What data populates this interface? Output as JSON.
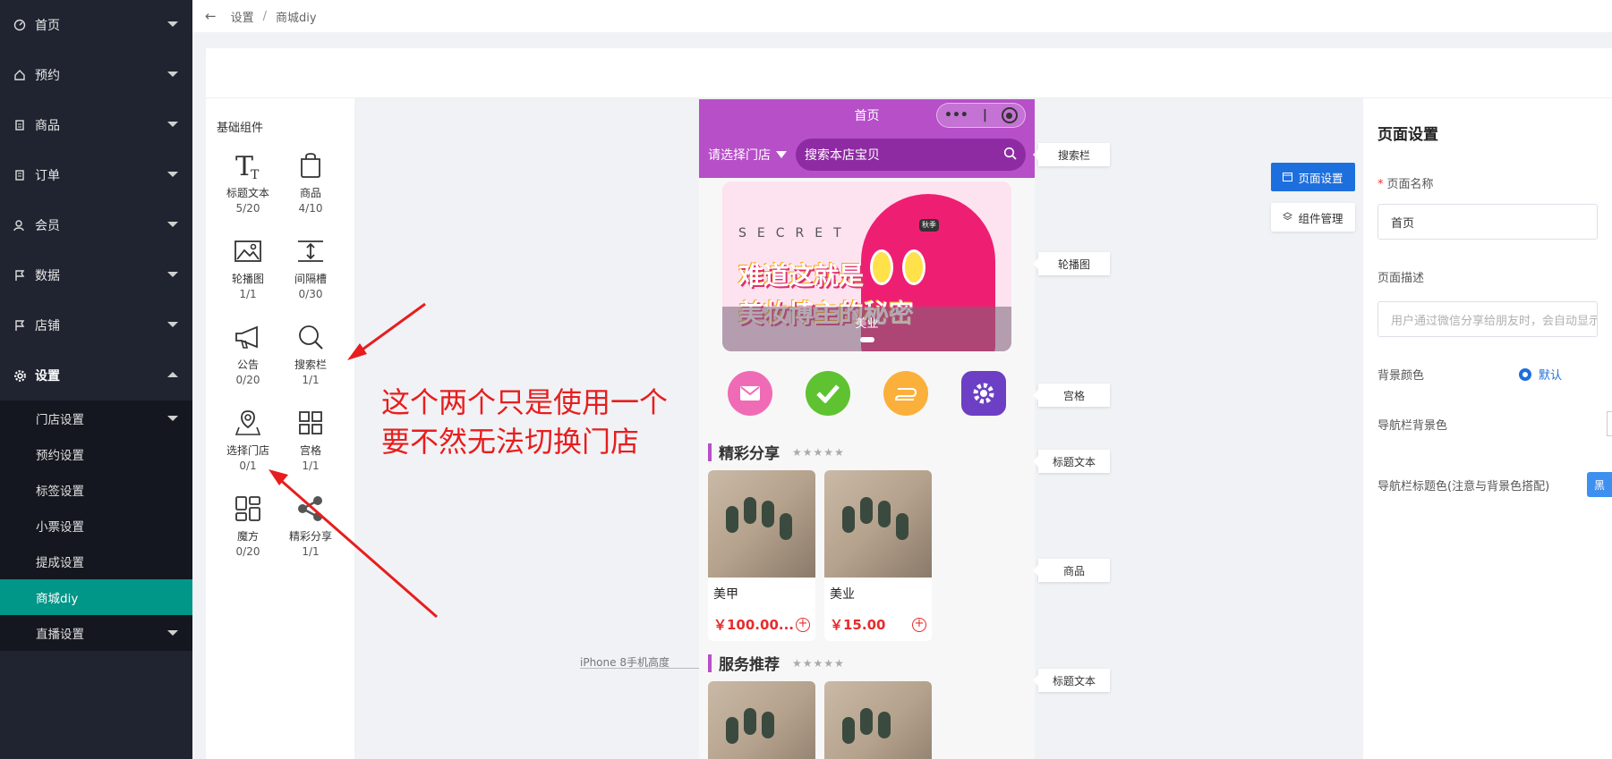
{
  "sidebar": {
    "items": [
      {
        "label": "首页",
        "icon": "dashboard-icon"
      },
      {
        "label": "预约",
        "icon": "home-icon"
      },
      {
        "label": "商品",
        "icon": "document-icon"
      },
      {
        "label": "订单",
        "icon": "order-icon"
      },
      {
        "label": "会员",
        "icon": "user-icon"
      },
      {
        "label": "数据",
        "icon": "flag-icon"
      },
      {
        "label": "店铺",
        "icon": "flag-icon"
      },
      {
        "label": "设置",
        "icon": "gear-icon"
      }
    ],
    "submenu": [
      {
        "label": "门店设置"
      },
      {
        "label": "预约设置"
      },
      {
        "label": "标签设置"
      },
      {
        "label": "小票设置"
      },
      {
        "label": "提成设置"
      },
      {
        "label": "商城diy"
      },
      {
        "label": "直播设置"
      }
    ]
  },
  "breadcrumb": {
    "parent": "设置",
    "current": "商城diy",
    "separator": "/"
  },
  "palette": {
    "title": "基础组件",
    "items": [
      {
        "name": "标题文本",
        "count": "5/20",
        "icon": "title-text-icon"
      },
      {
        "name": "商品",
        "count": "4/10",
        "icon": "shopping-bag-icon"
      },
      {
        "name": "轮播图",
        "count": "1/1",
        "icon": "image-icon"
      },
      {
        "name": "间隔槽",
        "count": "0/30",
        "icon": "spacer-icon"
      },
      {
        "name": "公告",
        "count": "0/20",
        "icon": "megaphone-icon"
      },
      {
        "name": "搜索栏",
        "count": "1/1",
        "icon": "search-icon"
      },
      {
        "name": "选择门店",
        "count": "0/1",
        "icon": "map-pin-icon"
      },
      {
        "name": "宫格",
        "count": "1/1",
        "icon": "grid-icon"
      },
      {
        "name": "魔方",
        "count": "0/20",
        "icon": "cube-layout-icon"
      },
      {
        "name": "精彩分享",
        "count": "1/1",
        "icon": "share-icon"
      }
    ]
  },
  "annotation": {
    "line1": "这个两个只是使用一个",
    "line2": "要不然无法切换门店"
  },
  "phone": {
    "title": "首页",
    "store_select": "请选择门店",
    "search_placeholder": "搜索本店宝贝",
    "banner": {
      "secret": "SECRET",
      "line1": "难道这就是",
      "line2": "美妆博主的秘密",
      "caption": "美业",
      "badge": "秋季"
    },
    "sections": [
      {
        "title": "精彩分享",
        "stars": "★★★★★",
        "goods": [
          {
            "name": "美甲",
            "price": "￥100.00..."
          },
          {
            "name": "美业",
            "price": "￥15.00"
          }
        ]
      },
      {
        "title": "服务推荐",
        "stars": "★★★★★"
      }
    ],
    "iphone_label": "iPhone 8手机高度"
  },
  "tags": [
    "搜索栏",
    "轮播图",
    "宫格",
    "标题文本",
    "商品",
    "标题文本"
  ],
  "side_buttons": {
    "page_settings": "页面设置",
    "component_mgmt": "组件管理"
  },
  "props": {
    "title": "页面设置",
    "page_name_label": "页面名称",
    "page_name_value": "首页",
    "page_desc_label": "页面描述",
    "page_desc_placeholder": "用户通过微信分享给朋友时，会自动显示",
    "bg_color_label": "背景颜色",
    "bg_color_option": "默认",
    "nav_bg_label": "导航栏背景色",
    "nav_title_color_label": "导航栏标题色(注意与背景色搭配)",
    "nav_title_color_btn": "黑"
  },
  "colors": {
    "sidebar": "#1f2430",
    "active": "#009688",
    "brand": "#b64fc8",
    "primary": "#1d6fde",
    "price": "#e62c2c"
  }
}
